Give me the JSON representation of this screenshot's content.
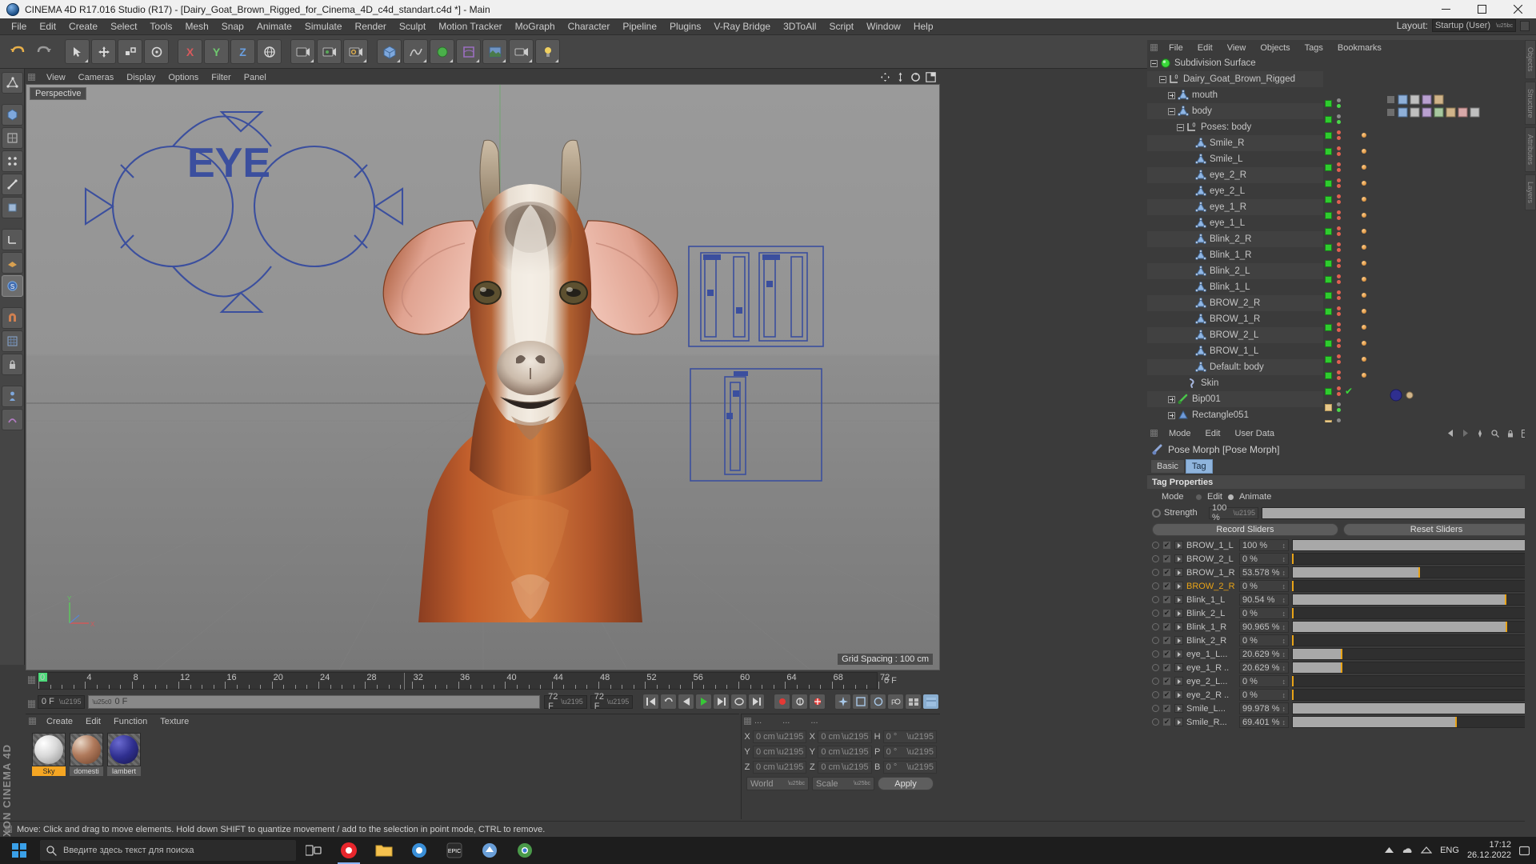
{
  "window": {
    "title": "CINEMA 4D R17.016 Studio (R17) - [Dairy_Goat_Brown_Rigged_for_Cinema_4D_c4d_standart.c4d *] - Main",
    "minimize": "–",
    "maximize": "□",
    "close": "✕"
  },
  "menu": {
    "items": [
      "File",
      "Edit",
      "Create",
      "Select",
      "Tools",
      "Mesh",
      "Snap",
      "Animate",
      "Simulate",
      "Render",
      "Sculpt",
      "Motion Tracker",
      "MoGraph",
      "Character",
      "Pipeline",
      "Plugins",
      "V-Ray Bridge",
      "3DToAll",
      "Script",
      "Window",
      "Help"
    ],
    "layout_label": "Layout:",
    "layout_value": "Startup (User)"
  },
  "viewport": {
    "menu": [
      "View",
      "Cameras",
      "Display",
      "Options",
      "Filter",
      "Panel"
    ],
    "perspective_label": "Perspective",
    "grid_spacing": "Grid Spacing : 100 cm",
    "axis_x": "X",
    "axis_y": "Y",
    "spline_text": "EYE"
  },
  "timeline": {
    "ticks": [
      "0",
      "4",
      "8",
      "12",
      "16",
      "20",
      "24",
      "28",
      "32",
      "36",
      "40",
      "44",
      "48",
      "52",
      "56",
      "60",
      "64",
      "68",
      "72"
    ],
    "end_label": "0 F",
    "current_frame": "0 F",
    "slider_value": "0 F",
    "range_end": "72 F",
    "range_max": "72 F"
  },
  "materials": {
    "menu": [
      "Create",
      "Edit",
      "Function",
      "Texture"
    ],
    "items": [
      {
        "name": "Sky",
        "selected": true,
        "color": "#efefef"
      },
      {
        "name": "domesti",
        "selected": false,
        "color": "#b07a5c"
      },
      {
        "name": "lambert",
        "selected": false,
        "color": "#2f2f8f"
      }
    ]
  },
  "coordinates": {
    "menu_dots": [
      "...",
      "...",
      "..."
    ],
    "rows": [
      {
        "l1": "X",
        "v1": "0 cm",
        "l2": "X",
        "v2": "0 cm",
        "l3": "H",
        "v3": "0 °"
      },
      {
        "l1": "Y",
        "v1": "0 cm",
        "l2": "Y",
        "v2": "0 cm",
        "l3": "P",
        "v3": "0 °"
      },
      {
        "l1": "Z",
        "v1": "0 cm",
        "l2": "Z",
        "v2": "0 cm",
        "l3": "B",
        "v3": "0 °"
      }
    ],
    "system": "World",
    "mode": "Scale",
    "apply": "Apply"
  },
  "status": {
    "message": "Move: Click and drag to move elements. Hold down SHIFT to quantize movement / add to the selection in point mode, CTRL to remove."
  },
  "object_manager": {
    "menu": [
      "File",
      "Edit",
      "View",
      "Objects",
      "Tags",
      "Bookmarks"
    ],
    "rows": [
      {
        "label": "Subdivision Surface",
        "indent": 0,
        "icon": "subdivision-surface",
        "expander": "minus",
        "green": true,
        "dots": "gray"
      },
      {
        "label": "Dairy_Goat_Brown_Rigged",
        "indent": 1,
        "icon": "layer-zero",
        "expander": "minus",
        "green": true,
        "dots": "gray"
      },
      {
        "label": "mouth",
        "indent": 2,
        "icon": "polygon",
        "expander": "plus",
        "green": true,
        "dots": "gray"
      },
      {
        "label": "body",
        "indent": 2,
        "icon": "polygon",
        "expander": "minus",
        "green": true,
        "dots": "gray"
      },
      {
        "label": "Poses: body",
        "indent": 3,
        "icon": "layer-zero",
        "expander": "minus",
        "green": true,
        "dots": "red"
      },
      {
        "label": "Smile_R",
        "indent": 4,
        "icon": "polygon",
        "expander": "none",
        "green": true,
        "dots": "red"
      },
      {
        "label": "Smile_L",
        "indent": 4,
        "icon": "polygon",
        "expander": "none",
        "green": true,
        "dots": "red"
      },
      {
        "label": "eye_2_R",
        "indent": 4,
        "icon": "polygon",
        "expander": "none",
        "green": true,
        "dots": "red"
      },
      {
        "label": "eye_2_L",
        "indent": 4,
        "icon": "polygon",
        "expander": "none",
        "green": true,
        "dots": "red"
      },
      {
        "label": "eye_1_R",
        "indent": 4,
        "icon": "polygon",
        "expander": "none",
        "green": true,
        "dots": "red"
      },
      {
        "label": "eye_1_L",
        "indent": 4,
        "icon": "polygon",
        "expander": "none",
        "green": true,
        "dots": "red"
      },
      {
        "label": "Blink_2_R",
        "indent": 4,
        "icon": "polygon",
        "expander": "none",
        "green": true,
        "dots": "red"
      },
      {
        "label": "Blink_1_R",
        "indent": 4,
        "icon": "polygon",
        "expander": "none",
        "green": true,
        "dots": "red"
      },
      {
        "label": "Blink_2_L",
        "indent": 4,
        "icon": "polygon",
        "expander": "none",
        "green": true,
        "dots": "red"
      },
      {
        "label": "Blink_1_L",
        "indent": 4,
        "icon": "polygon",
        "expander": "none",
        "green": true,
        "dots": "red"
      },
      {
        "label": "BROW_2_R",
        "indent": 4,
        "icon": "polygon",
        "expander": "none",
        "green": true,
        "dots": "red"
      },
      {
        "label": "BROW_1_R",
        "indent": 4,
        "icon": "polygon",
        "expander": "none",
        "green": true,
        "dots": "red"
      },
      {
        "label": "BROW_2_L",
        "indent": 4,
        "icon": "polygon",
        "expander": "none",
        "green": true,
        "dots": "red"
      },
      {
        "label": "BROW_1_L",
        "indent": 4,
        "icon": "polygon",
        "expander": "none",
        "green": true,
        "dots": "red"
      },
      {
        "label": "Default: body",
        "indent": 4,
        "icon": "polygon",
        "expander": "none",
        "green": true,
        "dots": "red"
      },
      {
        "label": "Skin",
        "indent": 3,
        "icon": "skin",
        "expander": "none",
        "green": true,
        "dots": "check"
      },
      {
        "label": "Bip001",
        "indent": 2,
        "icon": "joint",
        "expander": "plus",
        "green": false,
        "dots": "gray"
      },
      {
        "label": "Rectangle051",
        "indent": 2,
        "icon": "polygon-blue",
        "expander": "plus",
        "green": false,
        "dots": "gray"
      }
    ]
  },
  "attribute_manager": {
    "menu": [
      "Mode",
      "Edit",
      "User Data"
    ],
    "title": "Pose Morph [Pose Morph]",
    "tabs": [
      {
        "label": "Basic",
        "active": false
      },
      {
        "label": "Tag",
        "active": true
      }
    ],
    "section": "Tag Properties",
    "mode_label": "Mode",
    "mode_options": [
      {
        "label": "Edit",
        "selected": false
      },
      {
        "label": "Animate",
        "selected": true
      }
    ],
    "strength_label": "Strength",
    "strength_value": "100 %",
    "record_button": "Record Sliders",
    "reset_button": "Reset Sliders",
    "sliders": [
      {
        "name": "BROW_1_L",
        "value": "100 %",
        "pct": 100
      },
      {
        "name": "BROW_2_L",
        "value": "0 %",
        "pct": 0
      },
      {
        "name": "BROW_1_R",
        "value": "53.578 %",
        "pct": 53.578
      },
      {
        "name": "BROW_2_R",
        "value": "0 %",
        "pct": 0,
        "highlight": true
      },
      {
        "name": "Blink_1_L",
        "value": "90.54 %",
        "pct": 90.54
      },
      {
        "name": "Blink_2_L",
        "value": "0 %",
        "pct": 0
      },
      {
        "name": "Blink_1_R",
        "value": "90.965 %",
        "pct": 90.965
      },
      {
        "name": "Blink_2_R",
        "value": "0 %",
        "pct": 0
      },
      {
        "name": "eye_1_L...",
        "value": "20.629 %",
        "pct": 20.629
      },
      {
        "name": "eye_1_R ..",
        "value": "20.629 %",
        "pct": 20.629
      },
      {
        "name": "eye_2_L...",
        "value": "0 %",
        "pct": 0
      },
      {
        "name": "eye_2_R ..",
        "value": "0 %",
        "pct": 0
      },
      {
        "name": "Smile_L...",
        "value": "99.978 %",
        "pct": 99.978
      },
      {
        "name": "Smile_R...",
        "value": "69.401 %",
        "pct": 69.401
      }
    ]
  },
  "right_tabs": [
    "Objects",
    "Structure",
    "Attributes",
    "Layers"
  ],
  "branding": {
    "line1": "MAXON",
    "line2": "CINEMA 4D"
  },
  "taskbar": {
    "search_placeholder": "Введите здесь текст для поиска",
    "language": "ENG",
    "time": "17:12",
    "date": "26.12.2022"
  },
  "colors": {
    "accent_orange": "#e8a317",
    "green": "#2ecc2e",
    "spline_blue": "#3b4f9e",
    "tab_blue": "#8fb4dc"
  }
}
